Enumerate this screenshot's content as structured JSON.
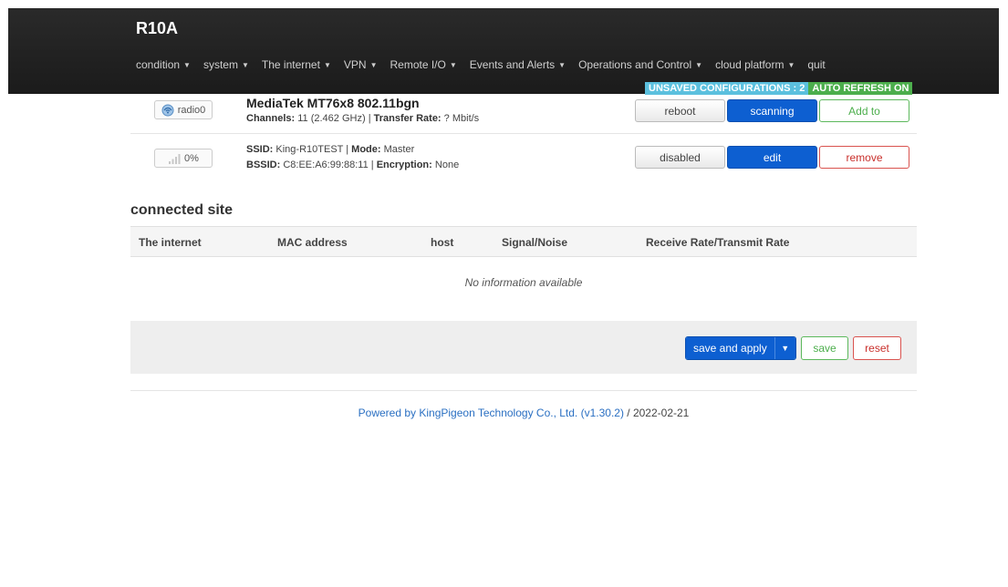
{
  "header": {
    "brand": "R10A",
    "menu": [
      {
        "label": "condition",
        "caret": "▼"
      },
      {
        "label": "system",
        "caret": "▼"
      },
      {
        "label": "The internet",
        "caret": "▼"
      },
      {
        "label": "VPN",
        "caret": "▼"
      },
      {
        "label": "Remote I/O",
        "caret": "▼"
      },
      {
        "label": "Events and Alerts",
        "caret": "▼"
      },
      {
        "label": "Operations and Control",
        "caret": "▼"
      },
      {
        "label": "cloud platform",
        "caret": "▼"
      },
      {
        "label": "quit",
        "caret": ""
      }
    ],
    "badges": {
      "unsaved": "UNSAVED CONFIGURATIONS : 2",
      "refresh": "AUTO REFRESH ON"
    }
  },
  "radio": {
    "chip": "radio0",
    "title": "MediaTek MT76x8 802.11bgn",
    "channels_label": "Channels:",
    "channels_value": "11 (2.462 GHz)",
    "rate_label": "Transfer Rate:",
    "rate_value": "? Mbit/s",
    "buttons": {
      "reboot": "reboot",
      "scanning": "scanning",
      "add": "Add to"
    }
  },
  "network": {
    "chip": "0%",
    "ssid_label": "SSID:",
    "ssid_value": "King-R10TEST",
    "mode_label": "Mode:",
    "mode_value": "Master",
    "bssid_label": "BSSID:",
    "bssid_value": "C8:EE:A6:99:88:11",
    "encryption_label": "Encryption:",
    "encryption_value": "None",
    "separator": "|",
    "buttons": {
      "disabled": "disabled",
      "edit": "edit",
      "remove": "remove"
    }
  },
  "stations": {
    "title": "connected site",
    "columns": [
      "The internet",
      "MAC address",
      "host",
      "Signal/Noise",
      "Receive Rate/Transmit Rate"
    ],
    "empty": "No information available"
  },
  "actions": {
    "save_apply": "save and apply",
    "caret": "▼",
    "save": "save",
    "reset": "reset"
  },
  "footer": {
    "link": "Powered by KingPigeon Technology Co., Ltd. (v1.30.2)",
    "date": " / 2022-02-21"
  },
  "colors": {
    "primary": "#0d5fd1",
    "success": "#5cb85c",
    "danger": "#d9534f",
    "info": "#5bc0de"
  }
}
